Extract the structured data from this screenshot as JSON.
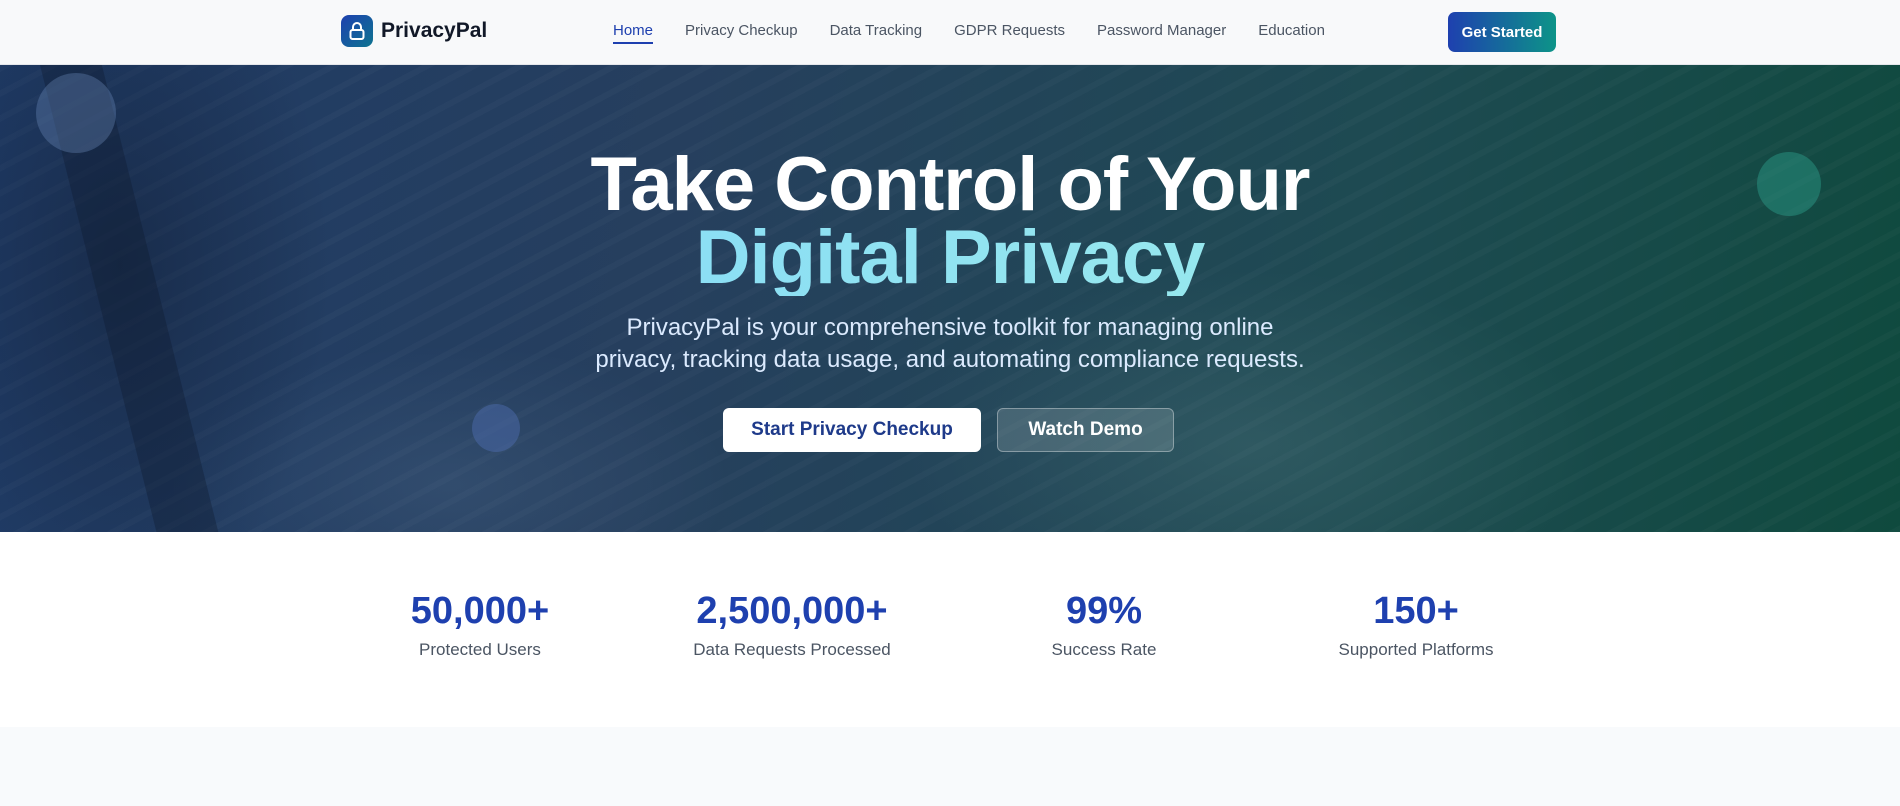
{
  "brand": {
    "name": "PrivacyPal",
    "logo_icon": "lock-icon"
  },
  "nav": {
    "links": [
      "Home",
      "Privacy Checkup",
      "Data Tracking",
      "GDPR Requests",
      "Password Manager",
      "Education"
    ],
    "active": "Home",
    "cta_label": "Get Started"
  },
  "hero": {
    "title_line1": "Take Control of Your",
    "title_line2": "Digital Privacy",
    "subtitle_line1": "PrivacyPal is your comprehensive toolkit for managing online",
    "subtitle_line2": "privacy, tracking data usage, and automating compliance requests.",
    "primary_button": "Start Privacy Checkup",
    "secondary_button": "Watch Demo"
  },
  "stats": [
    {
      "value": "50,000+",
      "label": "Protected Users"
    },
    {
      "value": "2,500,000+",
      "label": "Data Requests Processed"
    },
    {
      "value": "99%",
      "label": "Success Rate"
    },
    {
      "value": "150+",
      "label": "Supported Platforms"
    }
  ],
  "colors": {
    "accent": "#1e40af",
    "teal": "#0d9488",
    "gradient_text": "#7dd3fc"
  }
}
